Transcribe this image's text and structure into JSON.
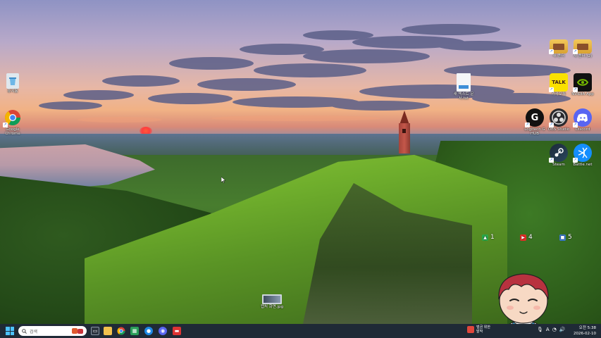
{
  "desktop_icons": [
    {
      "id": "recycle-bin",
      "label": "휴지통",
      "icon": "recycle-bin-icon"
    },
    {
      "id": "chrome",
      "label": "Google Chrome",
      "icon": "chrome-icon"
    },
    {
      "id": "folder-1",
      "label": "새 폴더",
      "icon": "folder-icon"
    },
    {
      "id": "folder-2",
      "label": "새 폴더 (2)",
      "icon": "folder-icon"
    },
    {
      "id": "kakaotalk",
      "label": "카카오톡",
      "icon": "kakaotalk-icon"
    },
    {
      "id": "nvidia",
      "label": "NVIDIA App",
      "icon": "nvidia-icon"
    },
    {
      "id": "text-file",
      "label": "새 텍스트 문서.txt",
      "icon": "file-icon"
    },
    {
      "id": "ghub",
      "label": "Logitech G HUB",
      "icon": "ghub-icon"
    },
    {
      "id": "obs",
      "label": "OBS Studio",
      "icon": "obs-icon"
    },
    {
      "id": "discord",
      "label": "Discord",
      "icon": "discord-icon"
    },
    {
      "id": "steam",
      "label": "Steam",
      "icon": "steam-icon"
    },
    {
      "id": "battlenet",
      "label": "Battle.net",
      "icon": "battlenet-icon"
    },
    {
      "id": "screenshot",
      "label": "캡처 화면.jpg",
      "icon": "image-file-icon"
    }
  ],
  "badges": [
    {
      "value": "1",
      "icon": "green-arrow-icon",
      "color": "#2aa84a"
    },
    {
      "value": "4",
      "icon": "youtube-icon",
      "color": "#e52d27"
    },
    {
      "value": "5",
      "icon": "blue-square-icon",
      "color": "#3b7dd8"
    }
  ],
  "taskbar": {
    "search_placeholder": "검색",
    "weather_line1": "벌금 위한",
    "weather_line2": "발작",
    "tray_lang": "A",
    "clock_time": "오전 5:38",
    "clock_date": "2026-02-10"
  },
  "colors": {
    "taskbar_bg": "#1f2a36",
    "windows_accent": "#4cc2ff"
  }
}
